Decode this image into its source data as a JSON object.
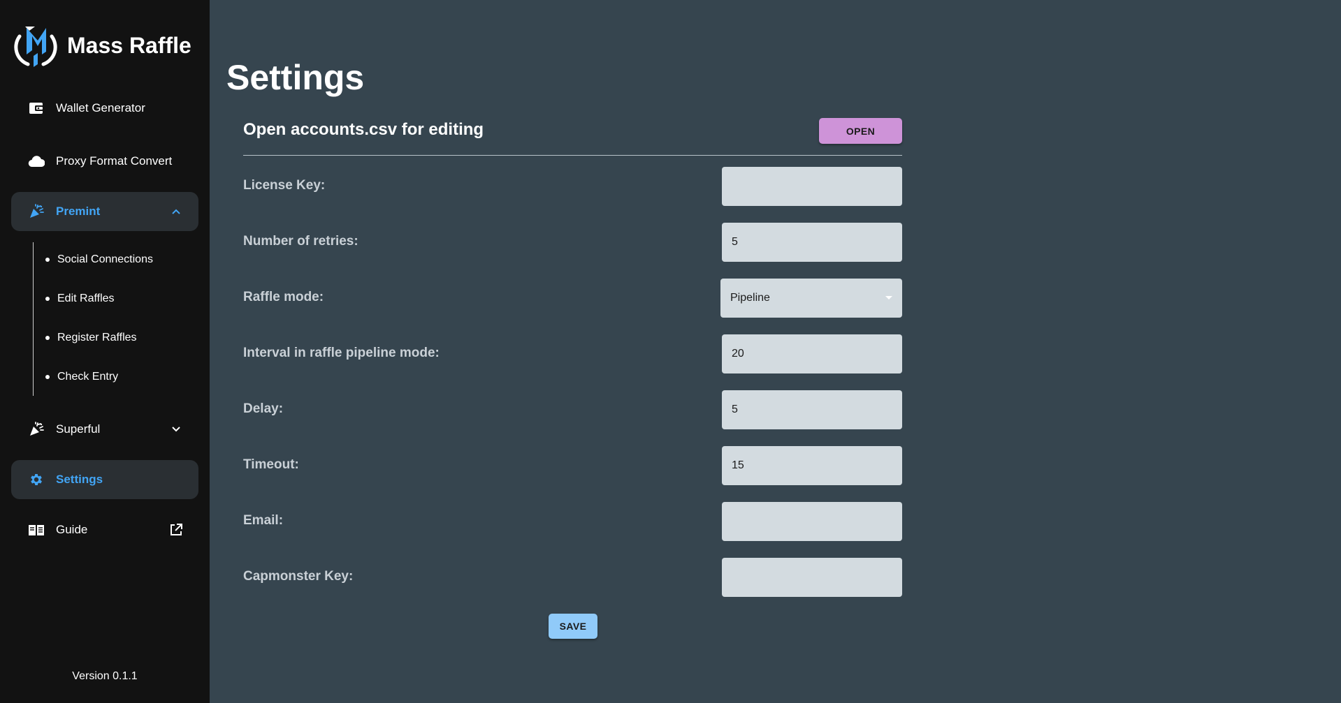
{
  "app": {
    "title": "Mass Raffle",
    "version": "Version 0.1.1",
    "accent_color": "#42a5f5"
  },
  "sidebar": {
    "items": [
      {
        "label": "Wallet Generator",
        "icon": "wallet-icon"
      },
      {
        "label": "Proxy Format Convert",
        "icon": "cloud-icon"
      },
      {
        "label": "Premint",
        "icon": "party-popper-icon",
        "expanded": true,
        "trail_icon": "chevron-up-icon"
      },
      {
        "label": "Superful",
        "icon": "party-popper-icon",
        "expanded": false,
        "trail_icon": "chevron-down-icon"
      },
      {
        "label": "Settings",
        "icon": "gear-icon",
        "active": true
      },
      {
        "label": "Guide",
        "icon": "book-icon",
        "trail_icon": "external-link-icon"
      }
    ],
    "premint_subitems": [
      {
        "label": "Social Connections"
      },
      {
        "label": "Edit Raffles"
      },
      {
        "label": "Register Raffles"
      },
      {
        "label": "Check Entry"
      }
    ]
  },
  "main": {
    "title": "Settings",
    "open_accounts": {
      "label": "Open accounts.csv for editing",
      "button": "OPEN",
      "button_color": "#ce93d8"
    },
    "fields": [
      {
        "label": "License Key:",
        "value": ""
      },
      {
        "label": "Number of retries:",
        "value": "5"
      },
      {
        "label": "Raffle mode:",
        "value": "Pipeline",
        "type": "select"
      },
      {
        "label": "Interval in raffle pipeline mode:",
        "value": "20"
      },
      {
        "label": "Delay:",
        "value": "5"
      },
      {
        "label": "Timeout:",
        "value": "15"
      },
      {
        "label": "Email:",
        "value": ""
      },
      {
        "label": "Capmonster Key:",
        "value": ""
      }
    ],
    "save_button": "SAVE",
    "save_button_color": "#90caf9"
  }
}
